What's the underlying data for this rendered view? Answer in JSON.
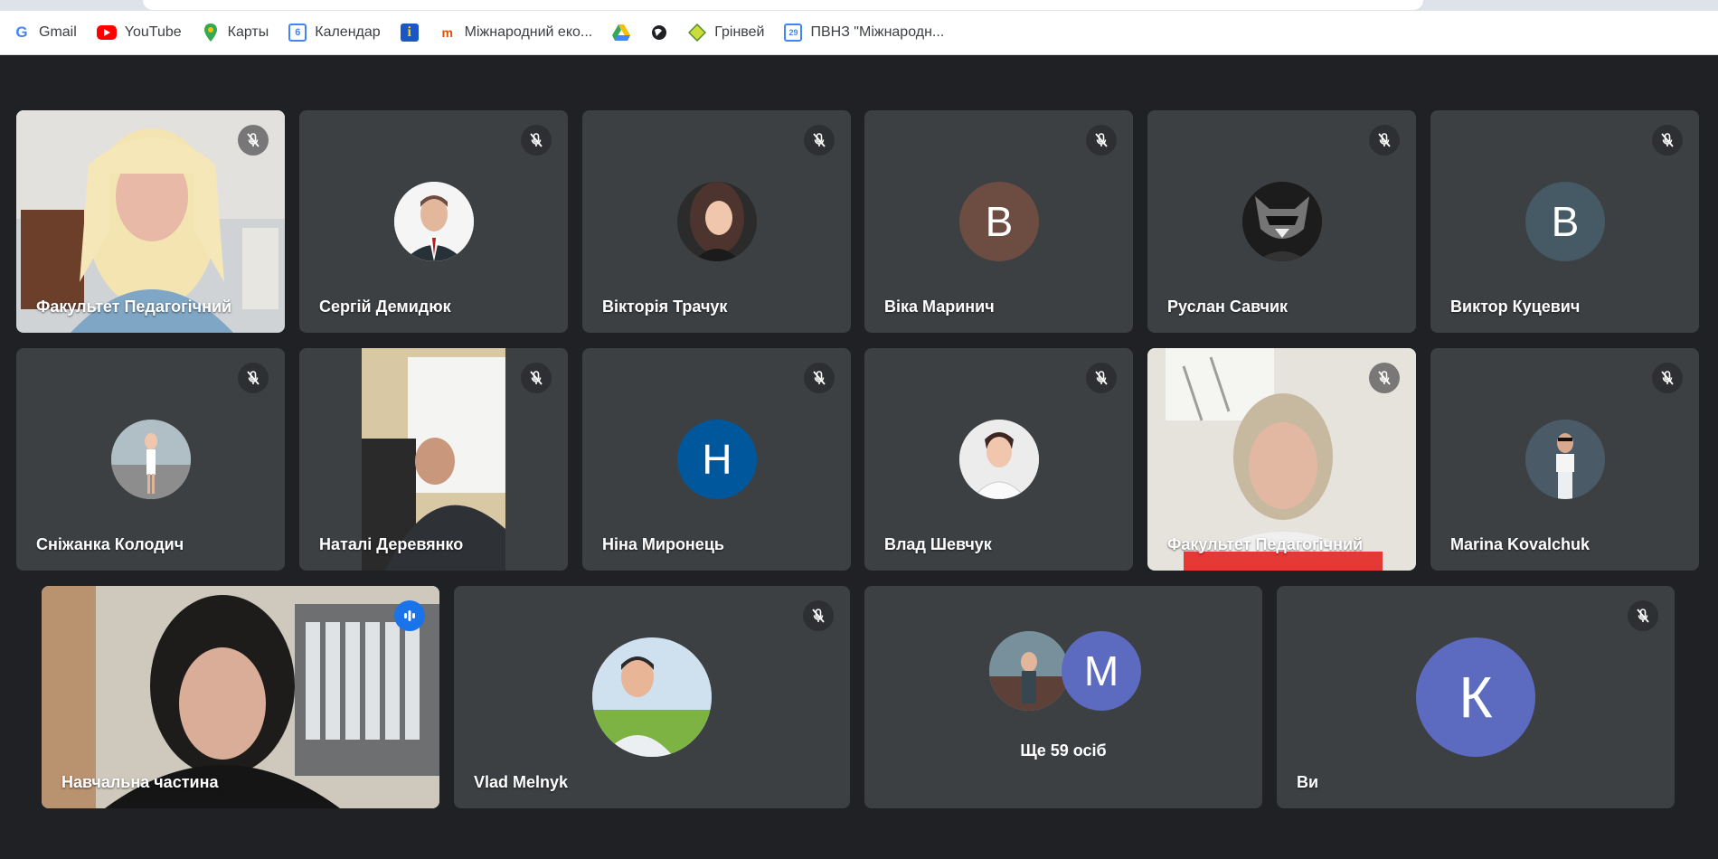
{
  "bookmarks": [
    {
      "label": "Gmail",
      "icon": "gmail-icon"
    },
    {
      "label": "YouTube",
      "icon": "youtube-icon"
    },
    {
      "label": "Карты",
      "icon": "maps-icon"
    },
    {
      "label": "Календар",
      "icon": "calendar-icon"
    },
    {
      "label": "",
      "icon": "info-icon"
    },
    {
      "label": "Міжнародний еко...",
      "icon": "site-icon"
    },
    {
      "label": "",
      "icon": "drive-icon"
    },
    {
      "label": "",
      "icon": "globe-icon"
    },
    {
      "label": "Грінвей",
      "icon": "greenway-icon"
    },
    {
      "label": "ПВНЗ \"Міжнародн...",
      "icon": "calendar-29-icon"
    }
  ],
  "participants": [
    {
      "name": "Факультет Педагогічний",
      "muted": true,
      "type": "video"
    },
    {
      "name": "Сергій Демидюк",
      "muted": true,
      "type": "photo"
    },
    {
      "name": "Вікторія Трачук",
      "muted": true,
      "type": "photo"
    },
    {
      "name": "Віка Маринич",
      "muted": true,
      "type": "letter",
      "letter": "В",
      "color": "#6d4c41"
    },
    {
      "name": "Руслан Савчик",
      "muted": true,
      "type": "photo"
    },
    {
      "name": "Виктор Куцевич",
      "muted": true,
      "type": "letter",
      "letter": "В",
      "color": "#455a64"
    },
    {
      "name": "Сніжанка Колодич",
      "muted": true,
      "type": "photo"
    },
    {
      "name": "Наталі Деревянко",
      "muted": true,
      "type": "video"
    },
    {
      "name": "Ніна Миронець",
      "muted": true,
      "type": "letter",
      "letter": "Н",
      "color": "#01579b"
    },
    {
      "name": "Влад Шевчук",
      "muted": true,
      "type": "photo"
    },
    {
      "name": "Факультет Педагогічний",
      "muted": true,
      "type": "video"
    },
    {
      "name": "Marina Kovalchuk",
      "muted": true,
      "type": "photo"
    },
    {
      "name": "Навчальна частина",
      "muted": false,
      "type": "video",
      "speaking": true
    },
    {
      "name": "Vlad Melnyk",
      "muted": true,
      "type": "photo"
    },
    {
      "name": "",
      "muted": false,
      "type": "more",
      "letter": "M",
      "more_label": "Ще 59 осіб"
    },
    {
      "name": "Ви",
      "muted": true,
      "type": "letter",
      "letter": "К",
      "color": "#5c6bc0"
    }
  ],
  "colors": {
    "background": "#202124",
    "tile": "#3c4043",
    "accent": "#8ab4f8",
    "speaking": "#1a73e8"
  }
}
